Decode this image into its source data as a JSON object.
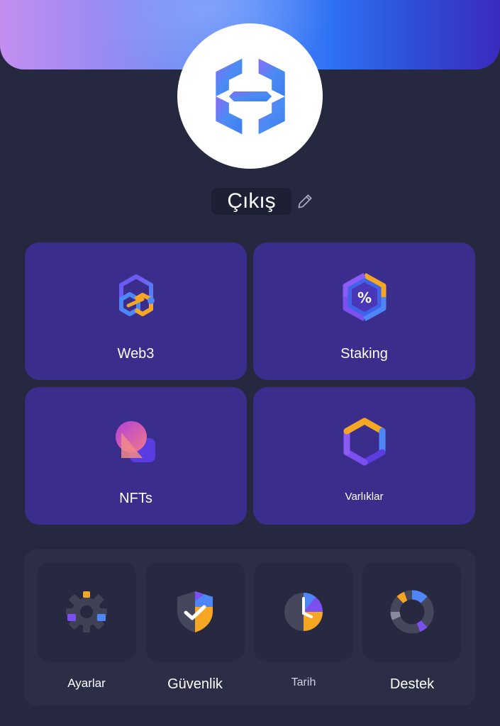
{
  "profile": {
    "name": "Çıkış",
    "logo_icon": "exodus-logo-icon",
    "edit_icon": "pencil-icon"
  },
  "tiles": {
    "web3": {
      "label": "Web3",
      "icon": "web3-hexagon-link-icon"
    },
    "staking": {
      "label": "Staking",
      "icon": "staking-percent-icon"
    },
    "nfts": {
      "label": "NFTs",
      "icon": "nft-shapes-icon"
    },
    "assets": {
      "label": "Varlıklar",
      "icon": "assets-hexagon-icon"
    }
  },
  "quick_actions": {
    "settings": {
      "label": "Ayarlar",
      "icon": "gear-icon"
    },
    "security": {
      "label": "Güvenlik",
      "icon": "shield-check-icon"
    },
    "history": {
      "label": "Tarih",
      "icon": "clock-icon"
    },
    "support": {
      "label": "Destek",
      "icon": "lifebuoy-icon"
    }
  },
  "colors": {
    "background": "#262840",
    "tile": "#3a2d8c",
    "panel": "#2c2e47",
    "accent_blue": "#4f86f7",
    "accent_purple": "#7b4ff0",
    "accent_orange": "#f5a623"
  }
}
